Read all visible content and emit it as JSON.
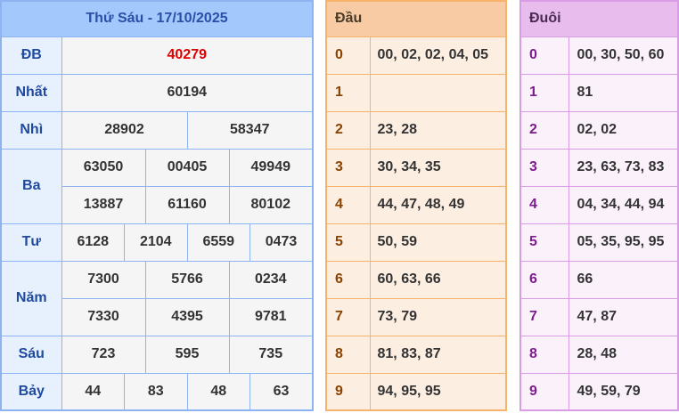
{
  "results": {
    "header": "Thứ Sáu - 17/10/2025",
    "rows": [
      {
        "label": "ĐB",
        "values": [
          "40279"
        ]
      },
      {
        "label": "Nhất",
        "values": [
          "60194"
        ]
      },
      {
        "label": "Nhì",
        "values": [
          "28902",
          "58347"
        ]
      },
      {
        "label": "Ba",
        "values": [
          "63050",
          "00405",
          "49949",
          "13887",
          "61160",
          "80102"
        ]
      },
      {
        "label": "Tư",
        "values": [
          "6128",
          "2104",
          "6559",
          "0473"
        ]
      },
      {
        "label": "Năm",
        "values": [
          "7300",
          "5766",
          "0234",
          "7330",
          "4395",
          "9781"
        ]
      },
      {
        "label": "Sáu",
        "values": [
          "723",
          "595",
          "735"
        ]
      },
      {
        "label": "Bảy",
        "values": [
          "44",
          "83",
          "48",
          "63"
        ]
      }
    ]
  },
  "dau": {
    "header": "Đầu",
    "rows": [
      {
        "key": "0",
        "value": "00, 02, 02, 04, 05"
      },
      {
        "key": "1",
        "value": ""
      },
      {
        "key": "2",
        "value": "23, 28"
      },
      {
        "key": "3",
        "value": "30, 34, 35"
      },
      {
        "key": "4",
        "value": "44, 47, 48, 49"
      },
      {
        "key": "5",
        "value": "50, 59"
      },
      {
        "key": "6",
        "value": "60, 63, 66"
      },
      {
        "key": "7",
        "value": "73, 79"
      },
      {
        "key": "8",
        "value": "81, 83, 87"
      },
      {
        "key": "9",
        "value": "94, 95, 95"
      }
    ]
  },
  "duoi": {
    "header": "Đuôi",
    "rows": [
      {
        "key": "0",
        "value": "00, 30, 50, 60"
      },
      {
        "key": "1",
        "value": "81"
      },
      {
        "key": "2",
        "value": "02, 02"
      },
      {
        "key": "3",
        "value": "23, 63, 73, 83"
      },
      {
        "key": "4",
        "value": "04, 34, 44, 94"
      },
      {
        "key": "5",
        "value": "05, 35, 95, 95"
      },
      {
        "key": "6",
        "value": "66"
      },
      {
        "key": "7",
        "value": "47, 87"
      },
      {
        "key": "8",
        "value": "28, 48"
      },
      {
        "key": "9",
        "value": "49, 59, 79"
      }
    ]
  },
  "colors": {
    "special_prize": "#e00000",
    "results_header_bg": "#a3c8fb",
    "dau_header_bg": "#f8cba5",
    "duoi_header_bg": "#e8bdee"
  }
}
